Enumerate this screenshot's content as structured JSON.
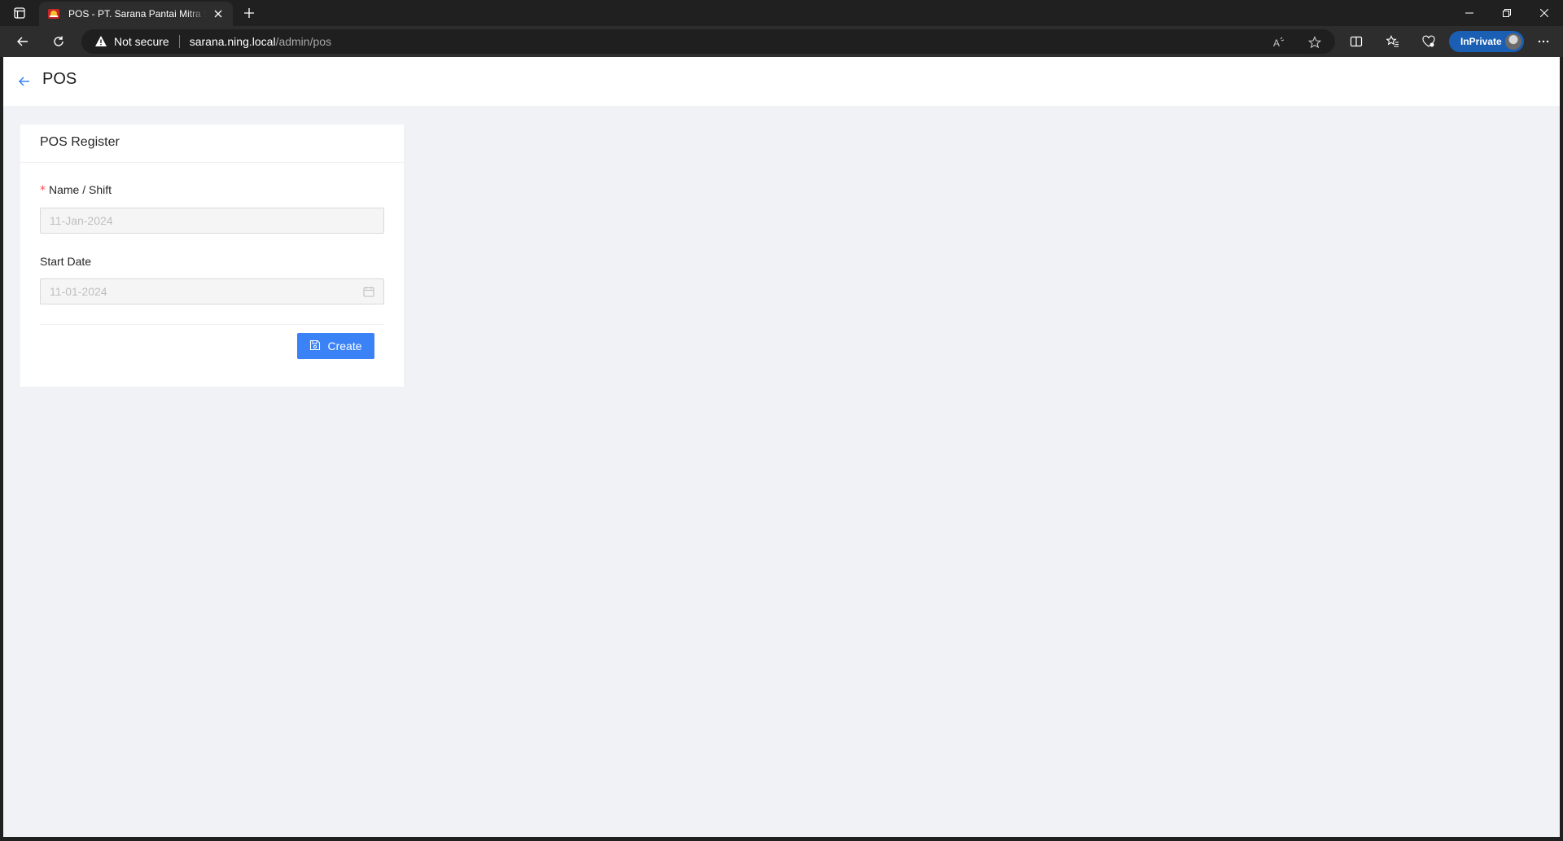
{
  "browser": {
    "tab_title": "POS - PT. Sarana Pantai Mitra Sejahtera",
    "security_label": "Not secure",
    "url_host": "sarana.ning.local",
    "url_path": "/admin/pos",
    "inprivate_label": "InPrivate"
  },
  "header": {
    "title": "POS"
  },
  "form": {
    "card_title": "POS Register",
    "name_label": "Name / Shift",
    "name_value": "11-Jan-2024",
    "start_date_label": "Start Date",
    "start_date_value": "11-01-2024",
    "create_label": "Create"
  },
  "colors": {
    "accent": "#3b82f6",
    "required": "#ff4d4f",
    "page_bg": "#f0f2f5"
  }
}
